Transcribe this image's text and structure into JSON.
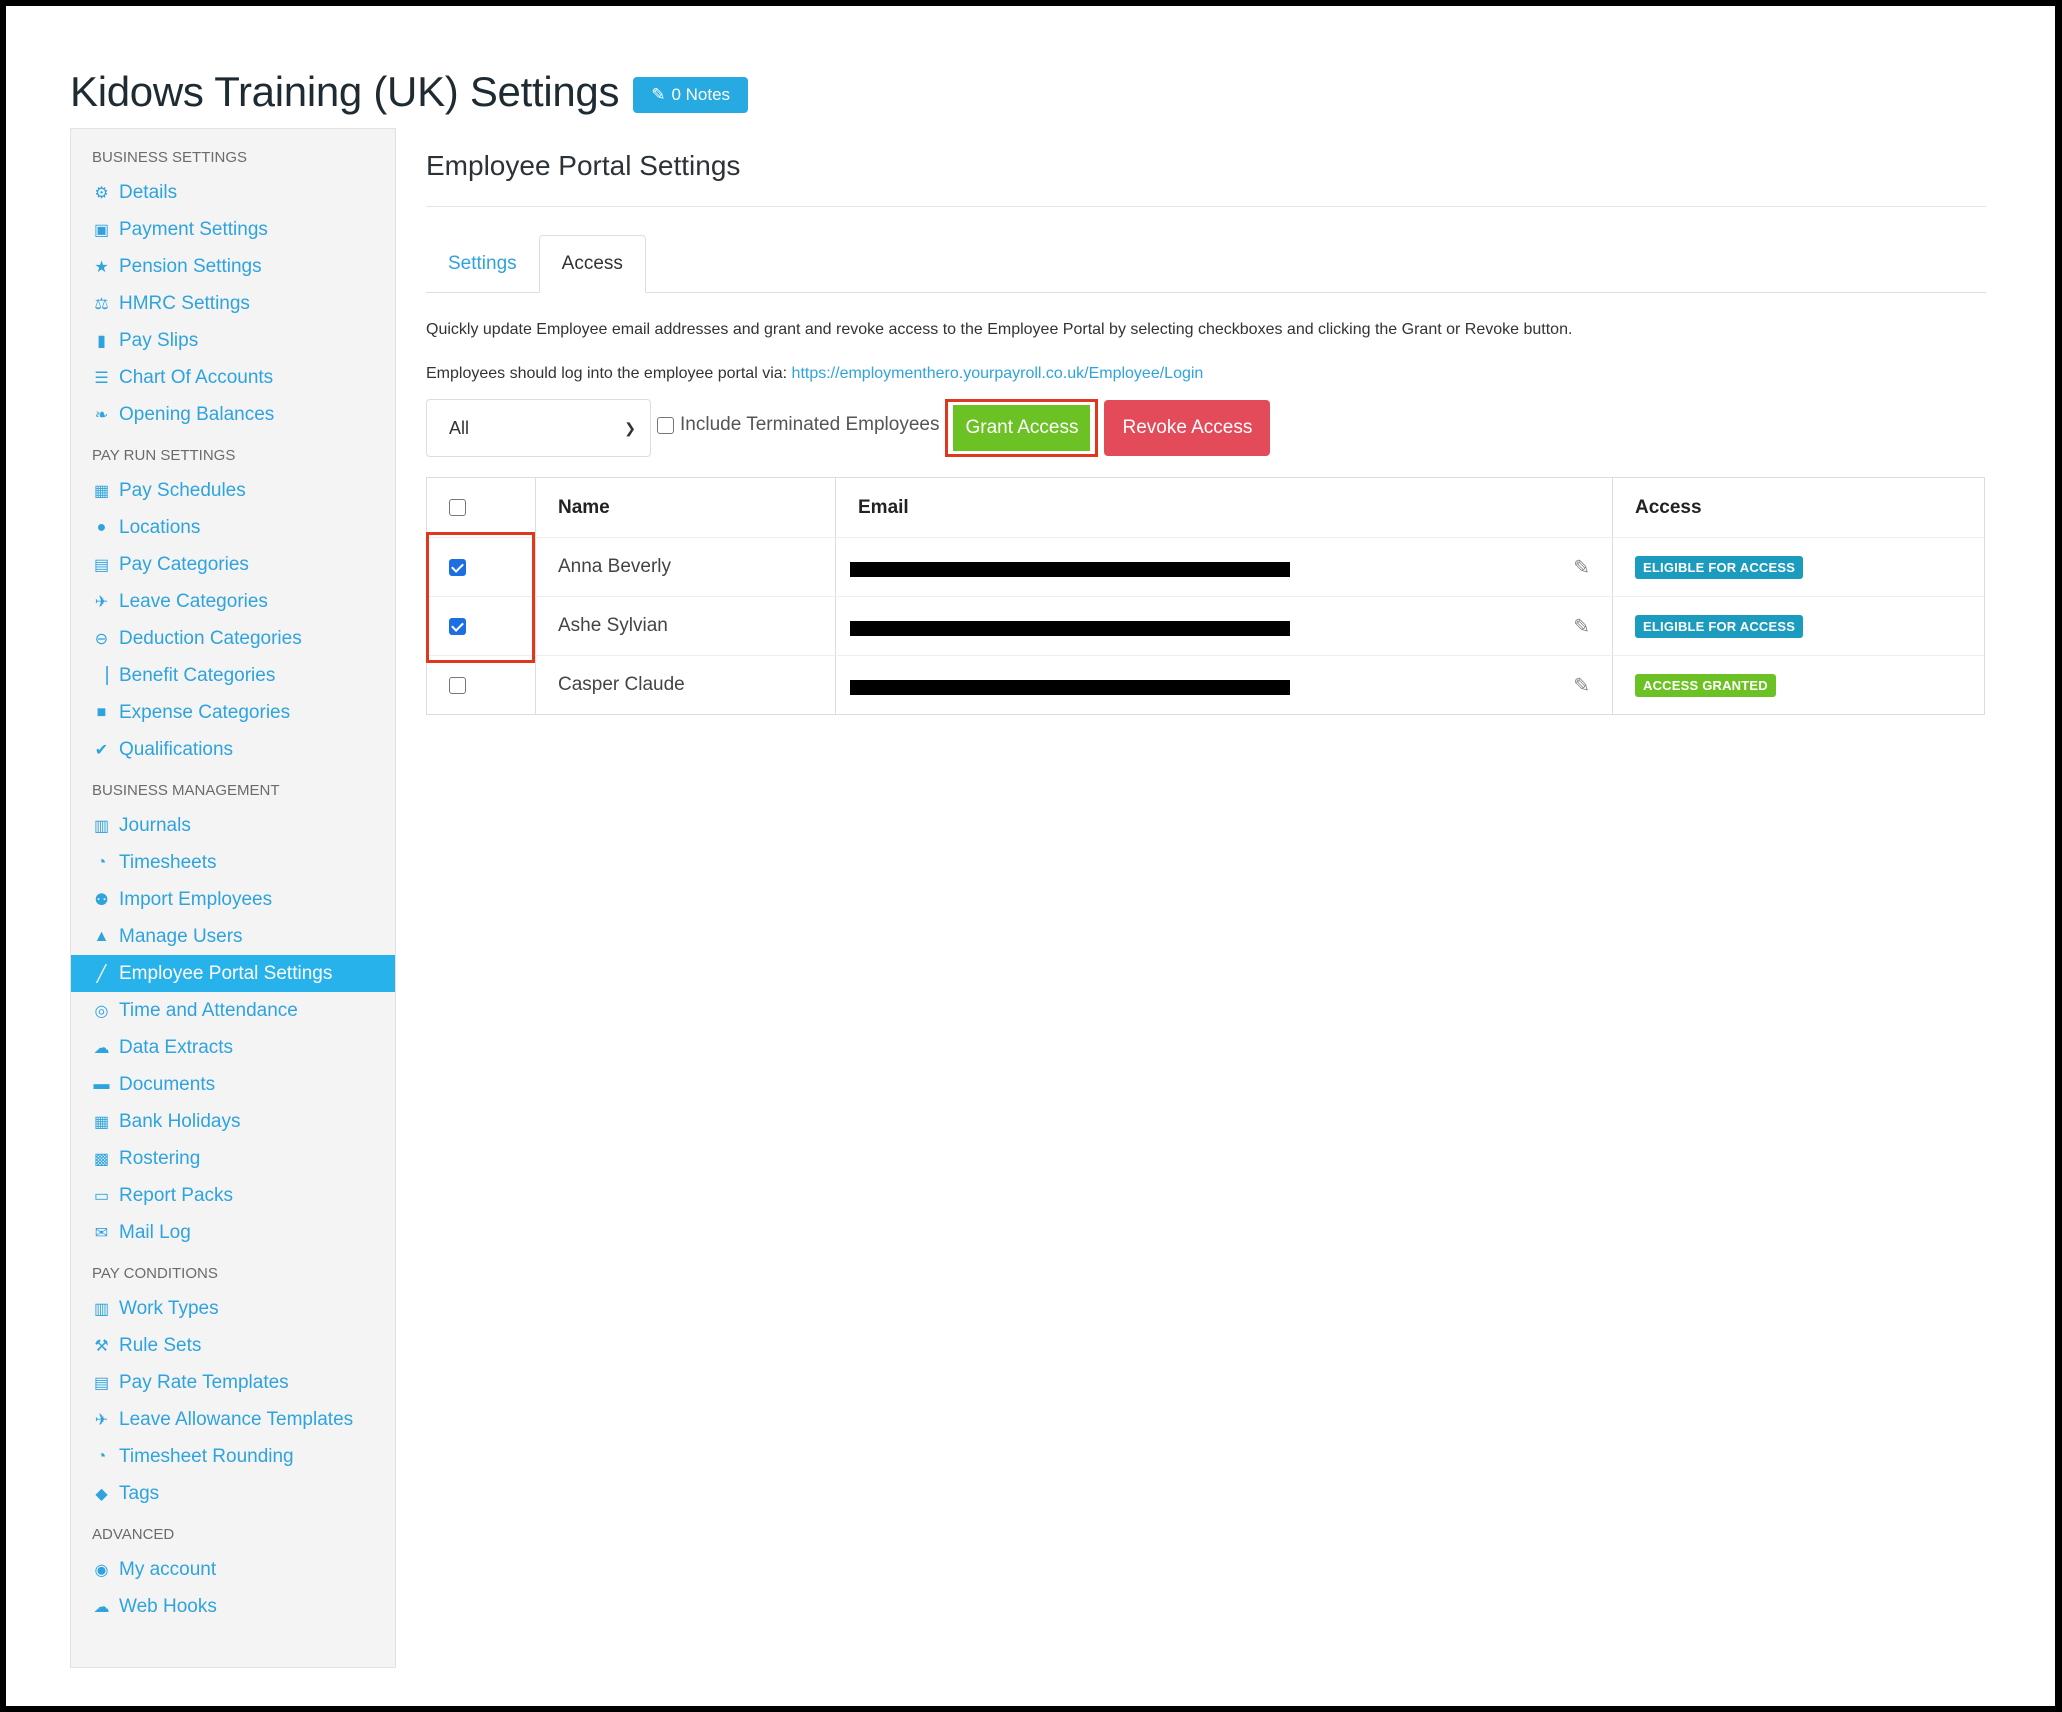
{
  "page": {
    "title": "Kidows Training (UK) Settings",
    "notes_label": "0 Notes"
  },
  "sidebar": {
    "sections": [
      {
        "heading": "BUSINESS SETTINGS",
        "items": [
          {
            "label": "Details",
            "icon": "gear-icon"
          },
          {
            "label": "Payment Settings",
            "icon": "floppy-icon"
          },
          {
            "label": "Pension Settings",
            "icon": "star-icon"
          },
          {
            "label": "HMRC Settings",
            "icon": "scales-icon"
          },
          {
            "label": "Pay Slips",
            "icon": "file-icon"
          },
          {
            "label": "Chart Of Accounts",
            "icon": "list-icon"
          },
          {
            "label": "Opening Balances",
            "icon": "leaf-icon"
          }
        ]
      },
      {
        "heading": "PAY RUN SETTINGS",
        "items": [
          {
            "label": "Pay Schedules",
            "icon": "calendar-icon"
          },
          {
            "label": "Locations",
            "icon": "globe-icon"
          },
          {
            "label": "Pay Categories",
            "icon": "money-icon"
          },
          {
            "label": "Leave Categories",
            "icon": "plane-icon"
          },
          {
            "label": "Deduction Categories",
            "icon": "minus-circle-icon"
          },
          {
            "label": "Benefit Categories",
            "icon": "chart-icon"
          },
          {
            "label": "Expense Categories",
            "icon": "archive-icon"
          },
          {
            "label": "Qualifications",
            "icon": "check-icon"
          }
        ]
      },
      {
        "heading": "BUSINESS MANAGEMENT",
        "items": [
          {
            "label": "Journals",
            "icon": "book-icon"
          },
          {
            "label": "Timesheets",
            "icon": "clock-icon"
          },
          {
            "label": "Import Employees",
            "icon": "people-icon"
          },
          {
            "label": "Manage Users",
            "icon": "lock-icon"
          },
          {
            "label": "Employee Portal Settings",
            "icon": "magic-wand-icon",
            "active": true
          },
          {
            "label": "Time and Attendance",
            "icon": "stopwatch-icon"
          },
          {
            "label": "Data Extracts",
            "icon": "cloud-download-icon"
          },
          {
            "label": "Documents",
            "icon": "folder-icon"
          },
          {
            "label": "Bank Holidays",
            "icon": "calendar-icon"
          },
          {
            "label": "Rostering",
            "icon": "calendar-grid-icon"
          },
          {
            "label": "Report Packs",
            "icon": "folder-open-icon"
          },
          {
            "label": "Mail Log",
            "icon": "envelope-icon"
          }
        ]
      },
      {
        "heading": "PAY CONDITIONS",
        "items": [
          {
            "label": "Work Types",
            "icon": "book-icon"
          },
          {
            "label": "Rule Sets",
            "icon": "gavel-icon"
          },
          {
            "label": "Pay Rate Templates",
            "icon": "money-icon"
          },
          {
            "label": "Leave Allowance Templates",
            "icon": "plane-icon"
          },
          {
            "label": "Timesheet Rounding",
            "icon": "clock-icon"
          },
          {
            "label": "Tags",
            "icon": "tag-icon"
          }
        ]
      },
      {
        "heading": "ADVANCED",
        "items": [
          {
            "label": "My account",
            "icon": "user-circle-icon"
          },
          {
            "label": "Web Hooks",
            "icon": "cloud-icon"
          }
        ]
      }
    ]
  },
  "main": {
    "section_title": "Employee Portal Settings",
    "tabs": [
      {
        "label": "Settings",
        "active": false
      },
      {
        "label": "Access",
        "active": true
      }
    ],
    "description": "Quickly update Employee email addresses and grant and revoke access to the Employee Portal by selecting checkboxes and clicking the Grant or Revoke button.",
    "login_prefix": "Employees should log into the employee portal via: ",
    "login_url": "https://employmenthero.yourpayroll.co.uk/Employee/Login",
    "filter_value": "All",
    "include_terminated_label": "Include Terminated Employees",
    "grant_label": "Grant Access",
    "revoke_label": "Revoke Access"
  },
  "table": {
    "headers": {
      "name": "Name",
      "email": "Email",
      "access": "Access"
    },
    "rows": [
      {
        "name": "Anna Beverly",
        "checked": true,
        "access": "ELIGIBLE FOR ACCESS",
        "status": "eligible"
      },
      {
        "name": "Ashe Sylvian",
        "checked": true,
        "access": "ELIGIBLE FOR ACCESS",
        "status": "eligible"
      },
      {
        "name": "Casper Claude",
        "checked": false,
        "access": "ACCESS GRANTED",
        "status": "granted"
      }
    ]
  },
  "colors": {
    "accent": "#27a9e1",
    "grant": "#6cc224",
    "revoke": "#e44b5a",
    "highlight": "#e0381e",
    "eligible": "#1b9bbd"
  }
}
